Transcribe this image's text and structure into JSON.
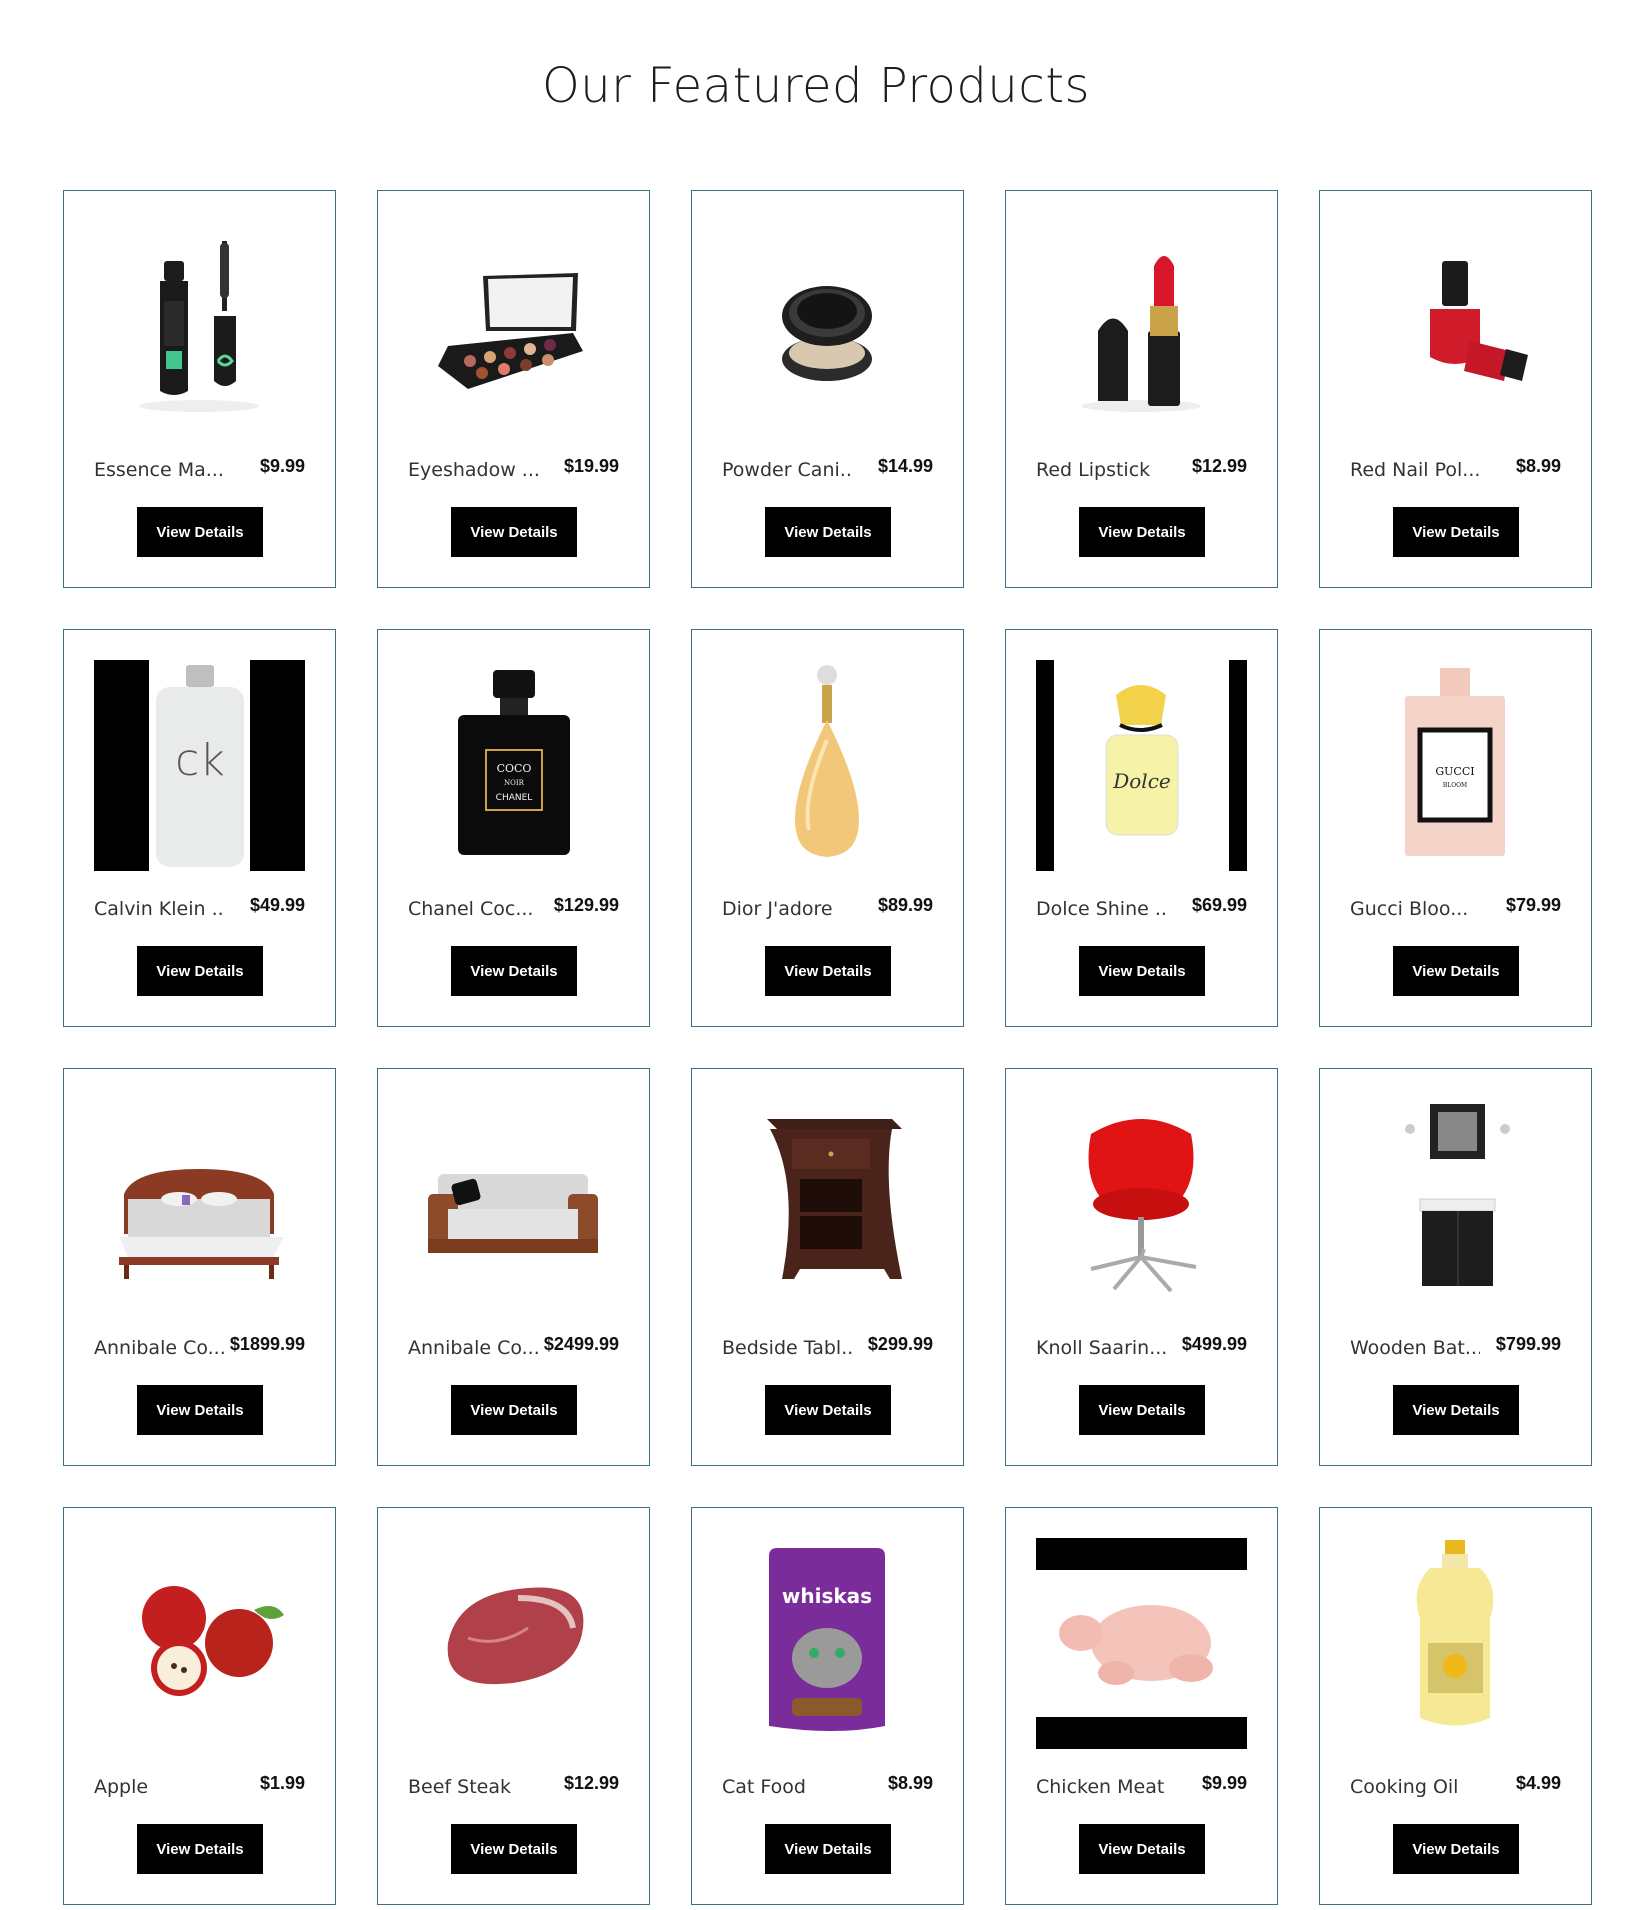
{
  "page": {
    "title": "Our Featured Products"
  },
  "button_label": "View Details",
  "products": [
    {
      "name": "Essence Ma...",
      "price": "$9.99",
      "icon": "mascara"
    },
    {
      "name": "Eyeshadow ...",
      "price": "$19.99",
      "icon": "eyeshadow-palette"
    },
    {
      "name": "Powder Cani...",
      "price": "$14.99",
      "icon": "powder-compact"
    },
    {
      "name": "Red Lipstick",
      "price": "$12.99",
      "icon": "lipstick"
    },
    {
      "name": "Red Nail Pol...",
      "price": "$8.99",
      "icon": "nail-polish"
    },
    {
      "name": "Calvin Klein ...",
      "price": "$49.99",
      "icon": "perfume-ck"
    },
    {
      "name": "Chanel Coc...",
      "price": "$129.99",
      "icon": "perfume-chanel"
    },
    {
      "name": "Dior J'adore",
      "price": "$89.99",
      "icon": "perfume-dior"
    },
    {
      "name": "Dolce Shine ...",
      "price": "$69.99",
      "icon": "perfume-dolce"
    },
    {
      "name": "Gucci Bloo...",
      "price": "$79.99",
      "icon": "perfume-gucci"
    },
    {
      "name": "Annibale Co...",
      "price": "$1899.99",
      "icon": "bed"
    },
    {
      "name": "Annibale Co...",
      "price": "$2499.99",
      "icon": "sofa"
    },
    {
      "name": "Bedside Tabl...",
      "price": "$299.99",
      "icon": "bedside-table"
    },
    {
      "name": "Knoll Saarin...",
      "price": "$499.99",
      "icon": "red-chair"
    },
    {
      "name": "Wooden Bat...",
      "price": "$799.99",
      "icon": "bathroom-vanity"
    },
    {
      "name": "Apple",
      "price": "$1.99",
      "icon": "apple"
    },
    {
      "name": "Beef Steak",
      "price": "$12.99",
      "icon": "steak"
    },
    {
      "name": "Cat Food",
      "price": "$8.99",
      "icon": "cat-food-pouch"
    },
    {
      "name": "Chicken Meat",
      "price": "$9.99",
      "icon": "chicken"
    },
    {
      "name": "Cooking Oil",
      "price": "$4.99",
      "icon": "oil-bottle"
    }
  ],
  "image_text": {
    "ck": "ck",
    "chanel": "COCO NOIR CHANEL",
    "gucci": "GUCCI BLOOM",
    "whiskas": "whiskas"
  },
  "colors": {
    "card_border": "#3f7281",
    "button_bg": "#000000",
    "button_text": "#ffffff"
  }
}
